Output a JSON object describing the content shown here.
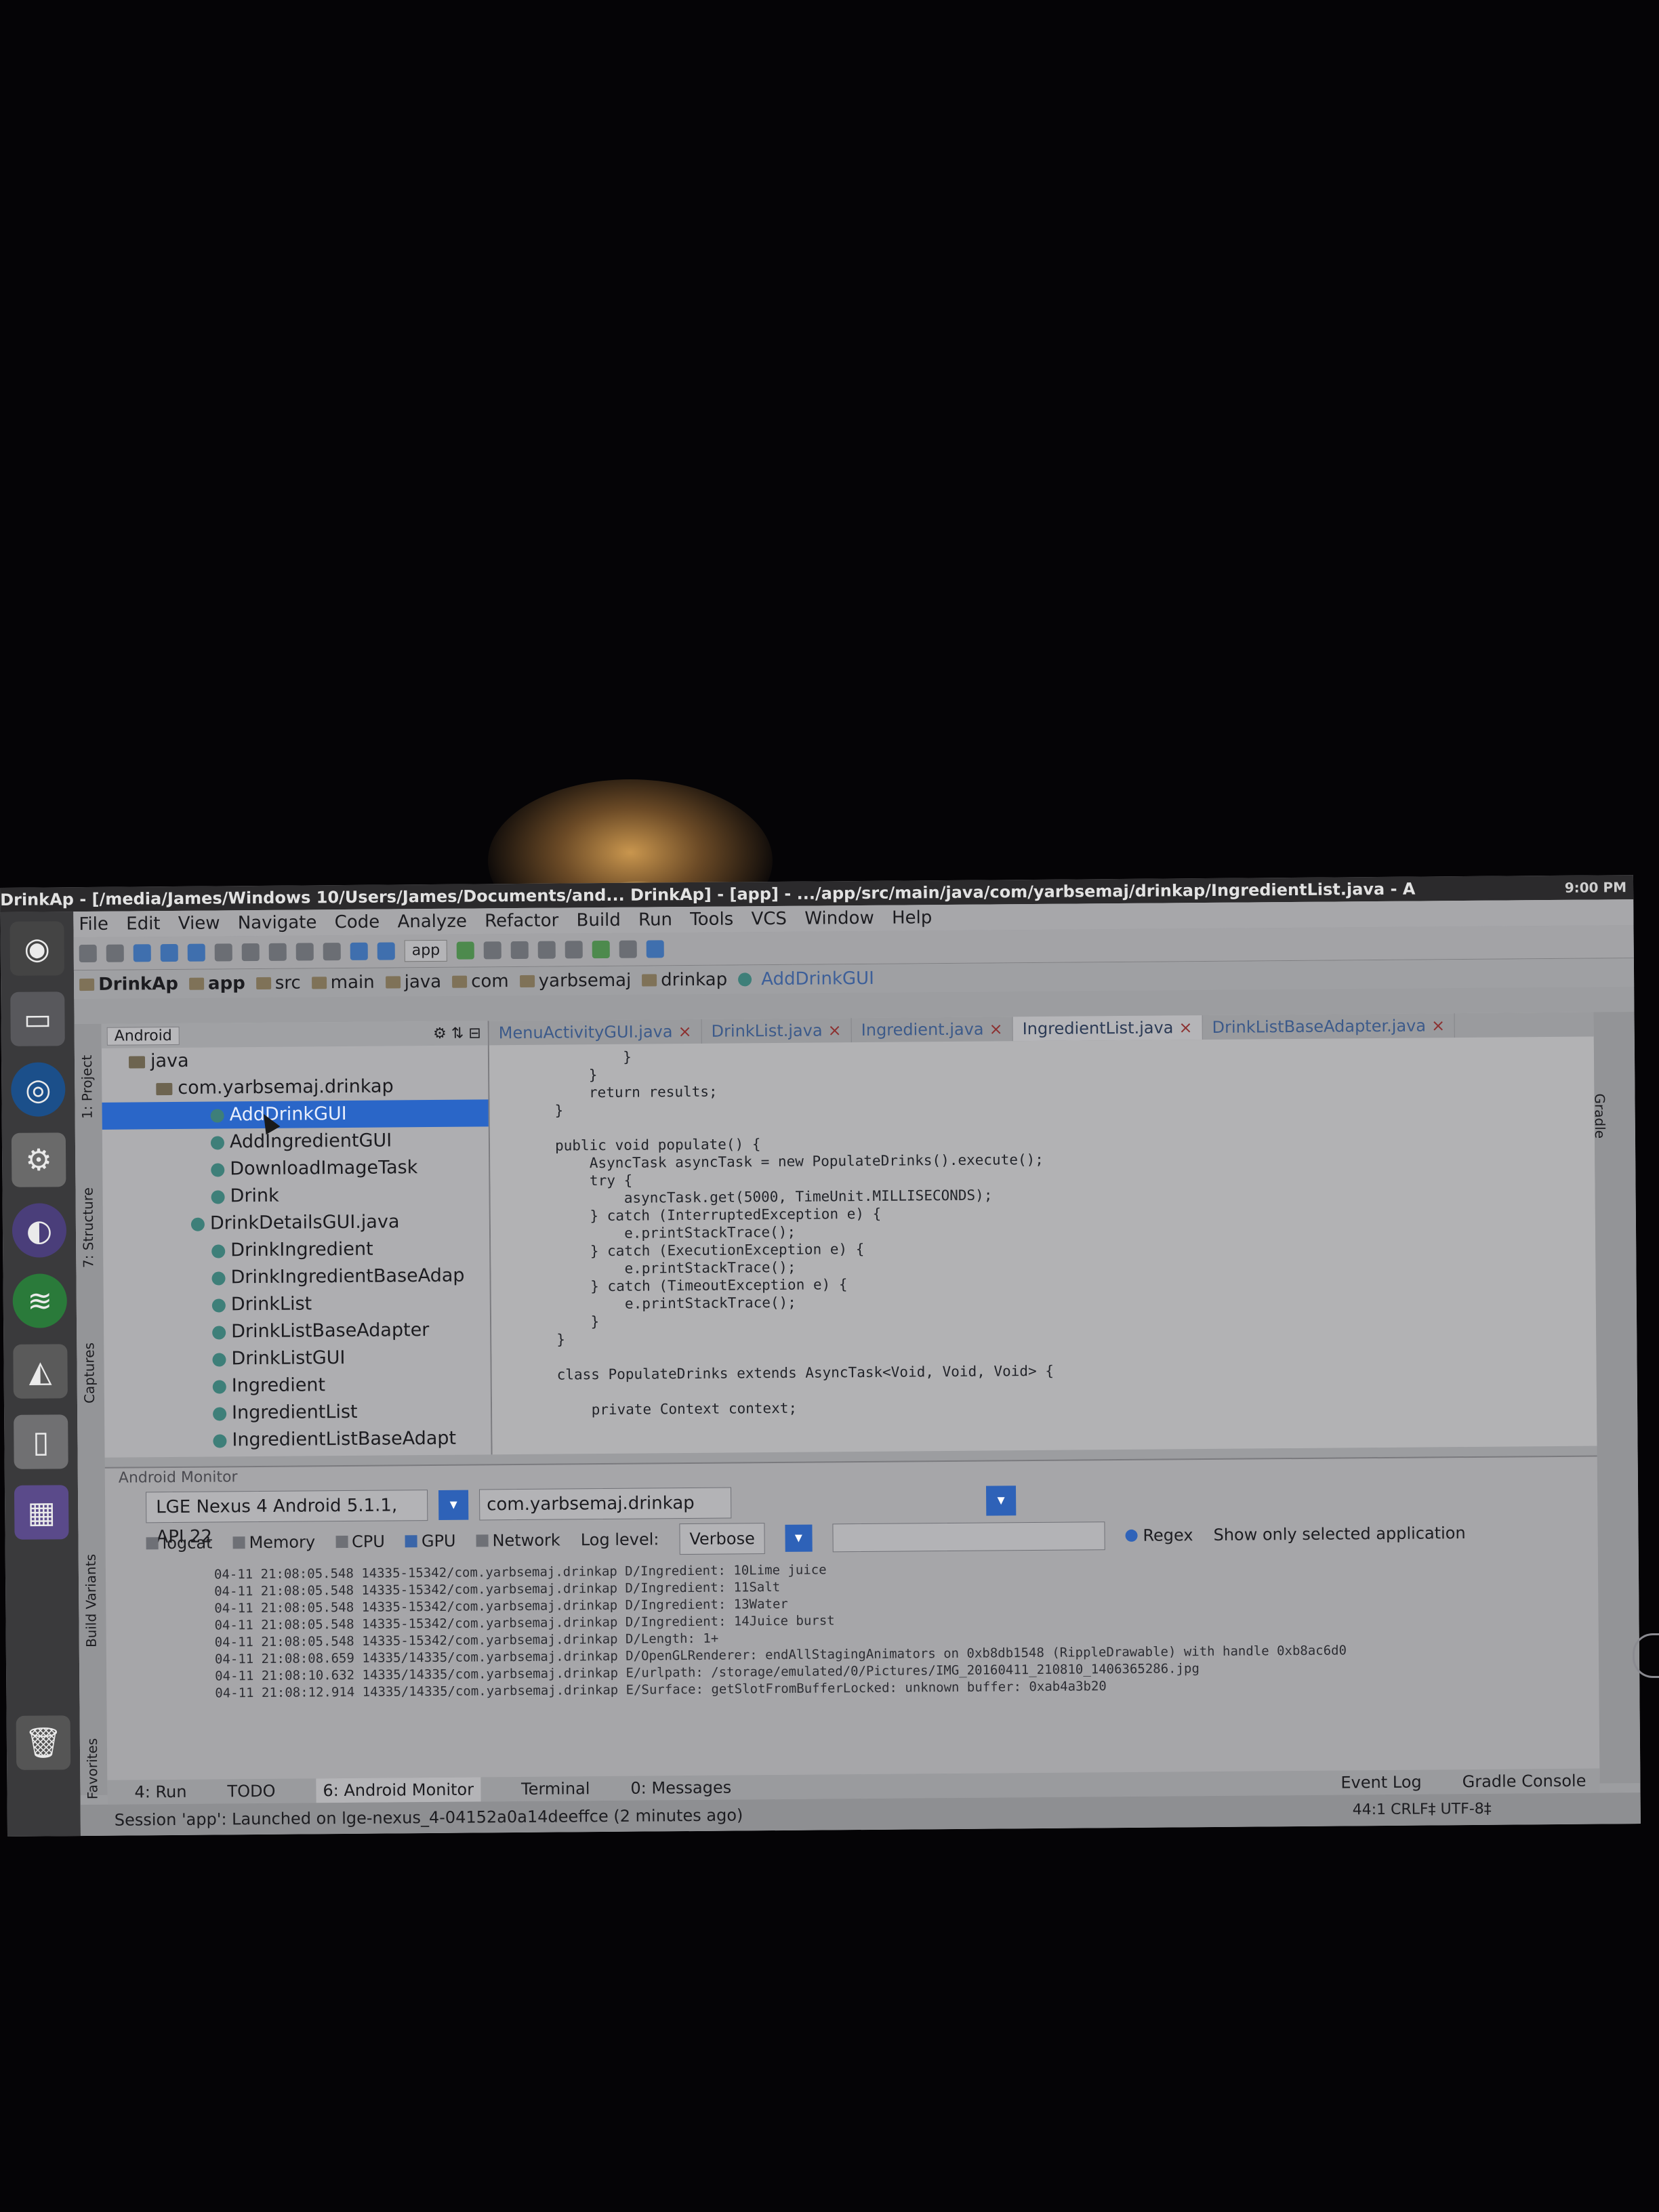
{
  "window": {
    "title": "DrinkAp - [/media/James/Windows 10/Users/James/Documents/and... DrinkAp] - [app] - .../app/src/main/java/com/yarbsemaj/drinkap/IngredientList.java - A",
    "tray": "9:00 PM"
  },
  "menu": [
    "File",
    "Edit",
    "View",
    "Navigate",
    "Code",
    "Analyze",
    "Refactor",
    "Build",
    "Run",
    "Tools",
    "VCS",
    "Window",
    "Help"
  ],
  "toolbar": {
    "config": "app"
  },
  "breadcrumbs": [
    "DrinkAp",
    "app",
    "src",
    "main",
    "java",
    "com",
    "yarbsemaj",
    "drinkap",
    "AddDrinkGUI"
  ],
  "project": {
    "view": "Android",
    "rows": [
      {
        "label": "java",
        "type": "folder",
        "indent": 40
      },
      {
        "label": "com.yarbsemaj.drinkap",
        "type": "folder",
        "indent": 80
      },
      {
        "label": "AddDrinkGUI",
        "type": "class",
        "indent": 160,
        "selected": true
      },
      {
        "label": "AddIngredientGUI",
        "type": "class",
        "indent": 160
      },
      {
        "label": "DownloadImageTask",
        "type": "class",
        "indent": 160
      },
      {
        "label": "Drink",
        "type": "class",
        "indent": 160
      },
      {
        "label": "DrinkDetailsGUI.java",
        "type": "class",
        "indent": 130
      },
      {
        "label": "DrinkIngredient",
        "type": "class",
        "indent": 160
      },
      {
        "label": "DrinkIngredientBaseAdap",
        "type": "class",
        "indent": 160
      },
      {
        "label": "DrinkList",
        "type": "class",
        "indent": 160
      },
      {
        "label": "DrinkListBaseAdapter",
        "type": "class",
        "indent": 160
      },
      {
        "label": "DrinkListGUI",
        "type": "class",
        "indent": 160
      },
      {
        "label": "Ingredient",
        "type": "class",
        "indent": 160
      },
      {
        "label": "IngredientList",
        "type": "class",
        "indent": 160
      },
      {
        "label": "IngredientListBaseAdapt",
        "type": "class",
        "indent": 160
      }
    ]
  },
  "left_tabs": [
    "1: Project",
    "7: Structure",
    "Captures",
    "Build Variants",
    "2: Favorites"
  ],
  "right_tabs": [
    "Gradle"
  ],
  "editor": {
    "tabs": [
      "MenuActivityGUI.java",
      "DrinkList.java",
      "Ingredient.java",
      "IngredientList.java",
      "DrinkListBaseAdapter.java"
    ],
    "active_tab": 3,
    "code": [
      "        }",
      "    }",
      "    return results;",
      "}",
      "",
      "public void populate() {",
      "    AsyncTask asyncTask = new PopulateDrinks().execute();",
      "    try {",
      "        asyncTask.get(5000, TimeUnit.MILLISECONDS);",
      "    } catch (InterruptedException e) {",
      "        e.printStackTrace();",
      "    } catch (ExecutionException e) {",
      "        e.printStackTrace();",
      "    } catch (TimeoutException e) {",
      "        e.printStackTrace();",
      "    }",
      "}",
      "",
      "class PopulateDrinks extends AsyncTask<Void, Void, Void> {",
      "",
      "    private Context context;"
    ]
  },
  "monitor": {
    "title": "Android Monitor",
    "device": "LGE Nexus 4 Android 5.1.1, API 22",
    "package": "com.yarbsemaj.drinkap",
    "tabs": [
      "logcat",
      "Memory",
      "CPU",
      "GPU",
      "Network"
    ],
    "log_level_label": "Log level:",
    "log_level": "Verbose",
    "regex_label": "Regex",
    "filter": "Show only selected application",
    "log": [
      "04-11 21:08:05.548 14335-15342/com.yarbsemaj.drinkap D/Ingredient: 10Lime juice",
      "04-11 21:08:05.548 14335-15342/com.yarbsemaj.drinkap D/Ingredient: 11Salt",
      "04-11 21:08:05.548 14335-15342/com.yarbsemaj.drinkap D/Ingredient: 13Water",
      "04-11 21:08:05.548 14335-15342/com.yarbsemaj.drinkap D/Ingredient: 14Juice burst",
      "04-11 21:08:05.548 14335-15342/com.yarbsemaj.drinkap D/Length: 1+",
      "04-11 21:08:08.659 14335/14335/com.yarbsemaj.drinkap D/OpenGLRenderer: endAllStagingAnimators on 0xb8db1548 (RippleDrawable) with handle 0xb8ac6d0",
      "04-11 21:08:10.632 14335/14335/com.yarbsemaj.drinkap E/urlpath: /storage/emulated/0/Pictures/IMG_20160411_210810_1406365286.jpg",
      "04-11 21:08:12.914 14335/14335/com.yarbsemaj.drinkap E/Surface: getSlotFromBufferLocked: unknown buffer: 0xab4a3b20"
    ]
  },
  "bottom_tabs": [
    "4: Run",
    "TODO",
    "6: Android Monitor",
    "Terminal",
    "0: Messages"
  ],
  "status": {
    "session": "Session 'app': Launched on lge-nexus_4-04152a0a14deeffce (2 minutes ago)",
    "right": "44:1  CRLF‡  UTF-8‡",
    "event_log": "Event Log",
    "gradle_console": "Gradle Console"
  }
}
